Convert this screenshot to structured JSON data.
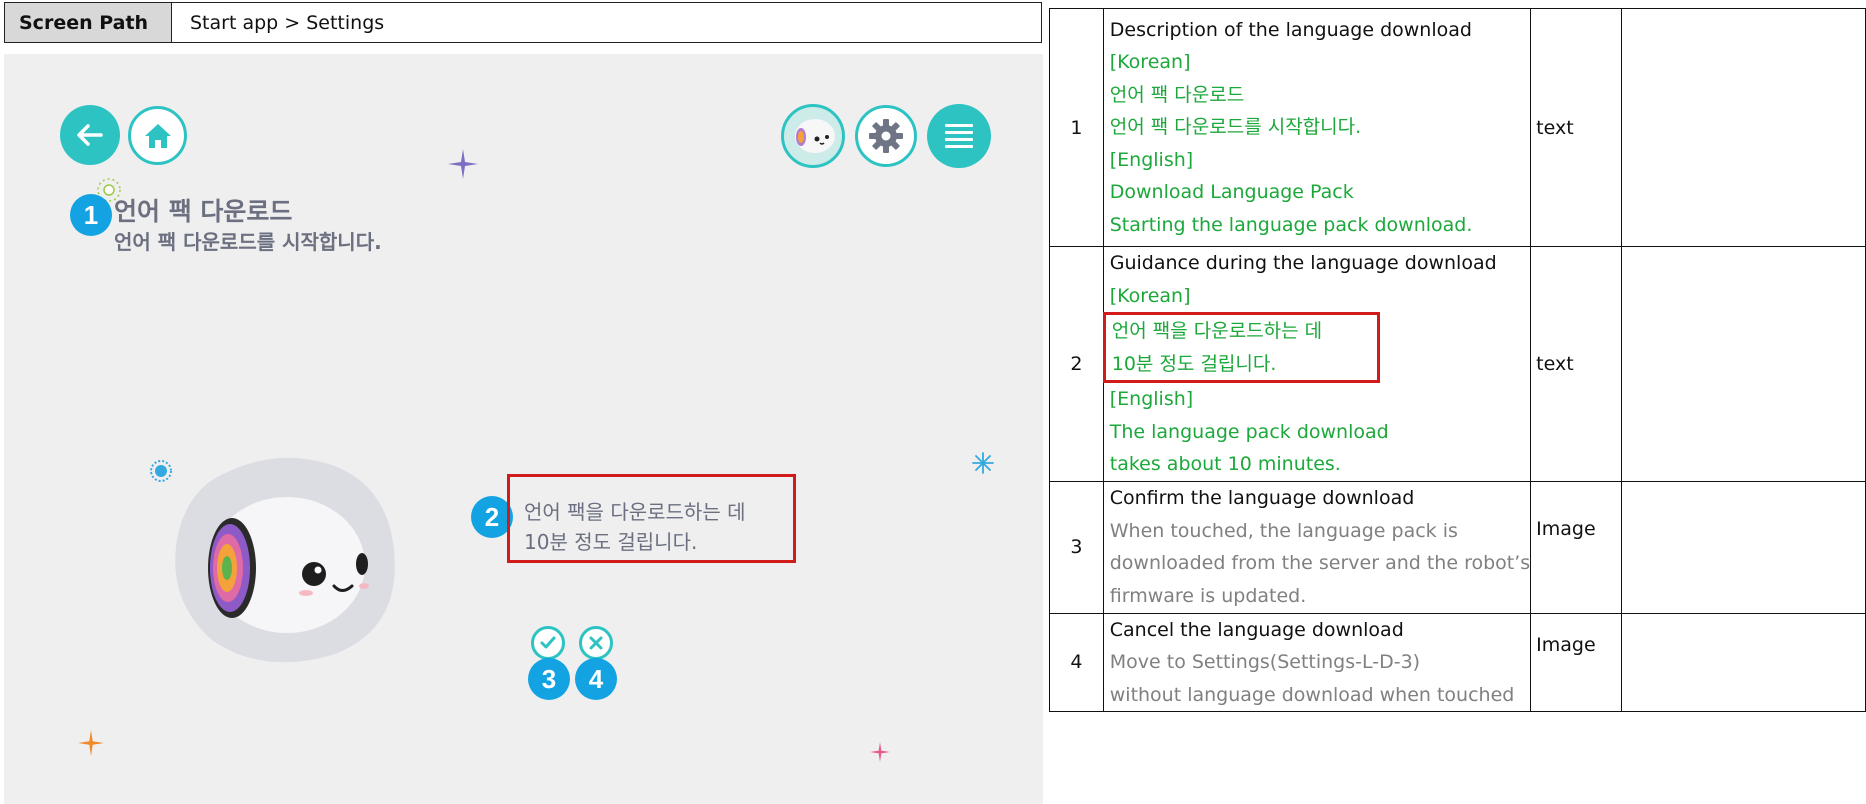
{
  "path": {
    "label": "Screen Path",
    "value": "Start app > Settings"
  },
  "screen": {
    "title": "언어 팩 다운로드",
    "subtitle": "언어 팩 다운로드를 시작합니다.",
    "guide_line1": "언어 팩을 다운로드하는 데",
    "guide_line2": "10분 정도 걸립니다.",
    "markers": [
      "1",
      "2",
      "3",
      "4"
    ],
    "icons": [
      "back-arrow-icon",
      "home-icon",
      "robot-avatar-icon",
      "gear-icon",
      "menu-icon",
      "check-icon",
      "close-icon"
    ],
    "accent": "#2ec3c3",
    "marker_color": "#13a3e3"
  },
  "table": {
    "rows": [
      {
        "num": "1",
        "desc_title": "Description of the language download",
        "lines": [
          "[Korean]",
          "언어 팩 다운로드",
          "언어 팩 다운로드를 시작합니다.",
          "[English]",
          "Download Language Pack",
          "Starting the language pack download."
        ],
        "type": "text"
      },
      {
        "num": "2",
        "desc_title": "Guidance during the language download",
        "lines": [
          "[Korean]",
          "언어 팩을 다운로드하는 데",
          "10분 정도 걸립니다.",
          "[English]",
          "The language pack download",
          "takes about 10 minutes."
        ],
        "type": "text"
      },
      {
        "num": "3",
        "desc_title": "Confirm the language download",
        "lines": [
          "When touched, the language pack is",
          "downloaded from the server and the robot’s",
          "firmware is updated."
        ],
        "type": "Image"
      },
      {
        "num": "4",
        "desc_title": "Cancel the language download",
        "lines": [
          "Move to Settings(Settings-L-D-3)",
          "without language download when touched"
        ],
        "type": "Image"
      }
    ],
    "green": "#1ca83a",
    "grey": "#808080",
    "highlight": "#d11a1a"
  }
}
